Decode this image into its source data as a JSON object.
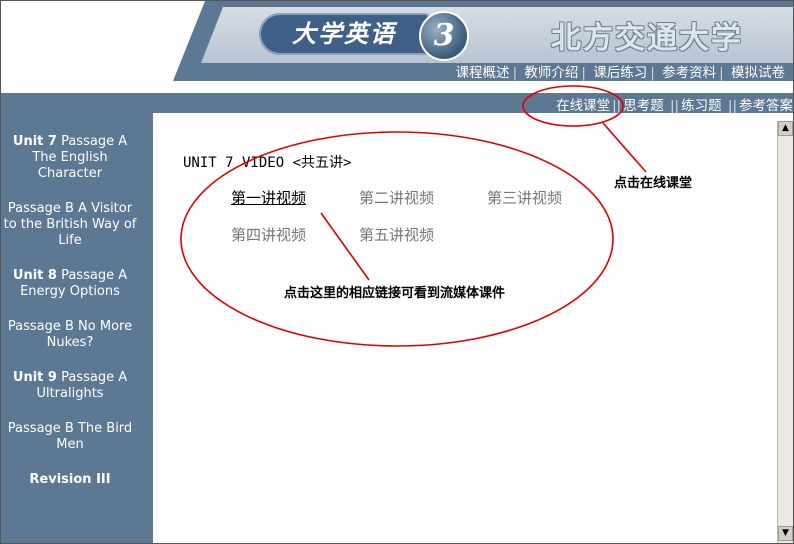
{
  "header": {
    "course_title": "大学英语",
    "course_volume": "3",
    "school_name": "北方交通大学",
    "nav": [
      "课程概述",
      "教师介绍",
      "课后练习",
      "参考资料",
      "模拟试卷"
    ]
  },
  "subnav": {
    "items": [
      "在线课堂",
      "思考题",
      "练习题",
      "参考答案"
    ]
  },
  "sidebar": {
    "items": [
      {
        "unit": "Unit 7",
        "text": " Passage A The English Character"
      },
      {
        "unit": "",
        "text": "Passage B A Visitor to the British Way of Life"
      },
      {
        "unit": "Unit 8",
        "text": " Passage A Energy Options"
      },
      {
        "unit": "",
        "text": "Passage B No More Nukes?"
      },
      {
        "unit": "Unit 9",
        "text": " Passage A Ultralights"
      },
      {
        "unit": "",
        "text": "Passage B The Bird Men"
      },
      {
        "unit": "Revision III",
        "text": ""
      }
    ]
  },
  "main": {
    "title": "UNIT 7 VIDEO <共五讲>",
    "videos": [
      "第一讲视频",
      "第二讲视频",
      "第三讲视频",
      "第四讲视频",
      "第五讲视频"
    ],
    "annotation_online": "点击在线课堂",
    "annotation_links": "点击这里的相应链接可看到流媒体课件"
  },
  "colors": {
    "band": "#5d7893",
    "annotation_red": "#e00000"
  },
  "icons": [
    "scroll-up-icon",
    "scroll-down-icon"
  ]
}
